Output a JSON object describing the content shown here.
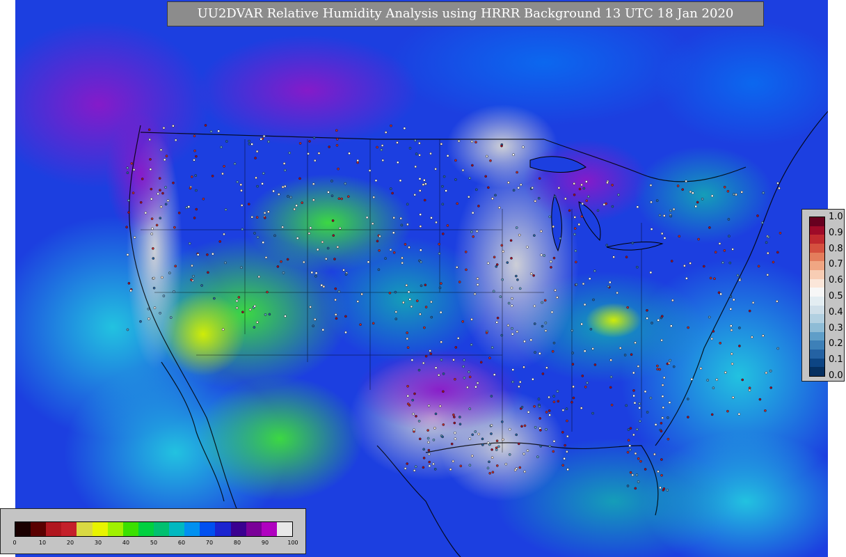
{
  "title": "UU2DVAR Relative Humidity Analysis using HRRR Background 13 UTC 18 Jan 2020",
  "obs_colorbar": {
    "ticks": [
      "1.0",
      "0.9",
      "0.8",
      "0.7",
      "0.6",
      "0.5",
      "0.4",
      "0.3",
      "0.2",
      "0.1",
      "0.0"
    ],
    "colors": [
      "#67001f",
      "#9e0a28",
      "#c0292f",
      "#d5503f",
      "#e47d5c",
      "#f0a683",
      "#f8cdb4",
      "#fbe6d9",
      "#f7f7f7",
      "#e3edf2",
      "#cfdfe9",
      "#b2d0e1",
      "#8ebcd6",
      "#5f9ec8",
      "#3d80b8",
      "#2462a3",
      "#0d4584",
      "#053061"
    ]
  },
  "rh_colorbar": {
    "ticks": [
      "0",
      "10",
      "20",
      "30",
      "40",
      "50",
      "60",
      "70",
      "80",
      "90",
      "100"
    ],
    "colors": [
      "#1a0000",
      "#5a0000",
      "#b0161e",
      "#c4202a",
      "#d9d943",
      "#e8f400",
      "#a0f000",
      "#3be000",
      "#00d040",
      "#00c070",
      "#00b8c0",
      "#0090f0",
      "#0050f0",
      "#1b24d0",
      "#3a0090",
      "#7a0098",
      "#b000c0",
      "#e8e8e8"
    ]
  }
}
